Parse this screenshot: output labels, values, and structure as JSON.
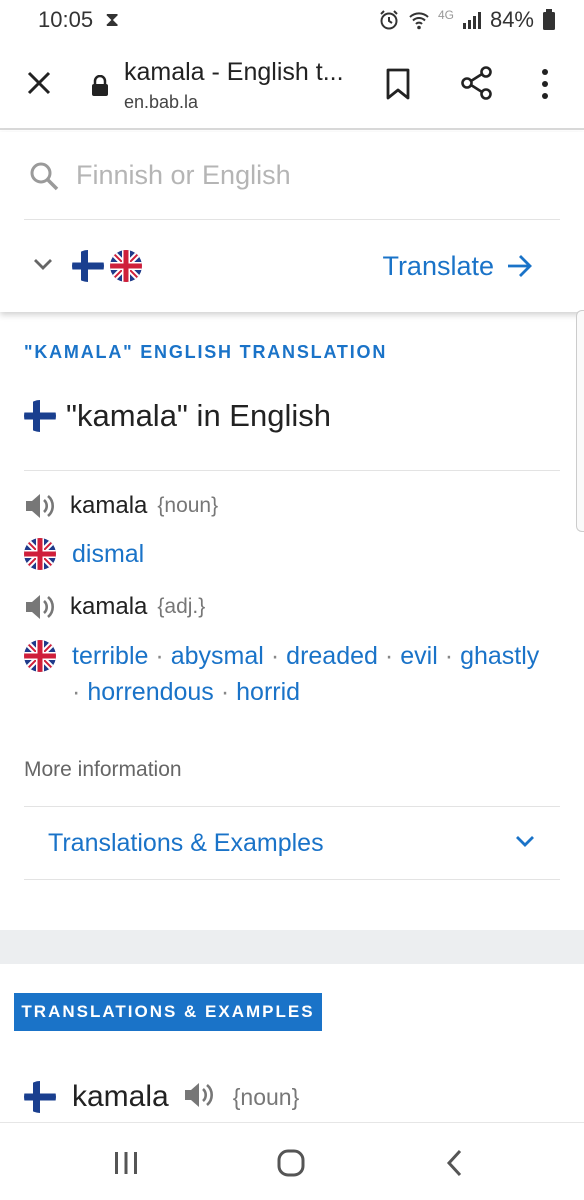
{
  "status_bar": {
    "time": "10:05",
    "network": "4G",
    "battery": "84%"
  },
  "browser": {
    "page_title": "kamala - English t...",
    "url": "en.bab.la"
  },
  "search": {
    "placeholder": "Finnish or English",
    "translate_label": "Translate"
  },
  "section": {
    "heading": "\"KAMALA\" ENGLISH TRANSLATION",
    "headword": "\"kamala\" in English"
  },
  "entries": [
    {
      "word": "kamala",
      "pos": "{noun}",
      "translations": [
        "dismal"
      ]
    },
    {
      "word": "kamala",
      "pos": "{adj.}",
      "translations": [
        "terrible",
        "abysmal",
        "dreaded",
        "evil",
        "ghastly",
        "horrendous",
        "horrid"
      ]
    }
  ],
  "more_info": {
    "label": "More information",
    "accordion_label": "Translations & Examples"
  },
  "examples": {
    "badge": "TRANSLATIONS & EXAMPLES",
    "word": "kamala",
    "pos": "{noun}"
  },
  "colors": {
    "accent": "#1a73c8",
    "text": "#222222",
    "muted": "#777777",
    "band": "#eceef0"
  },
  "icons": [
    "hourglass-icon",
    "alarm-icon",
    "wifi-icon",
    "signal-icon",
    "battery-icon",
    "close-icon",
    "lock-icon",
    "bookmark-icon",
    "share-icon",
    "more-vert-icon",
    "search-icon",
    "chevron-down-icon",
    "flag-finland-icon",
    "flag-uk-icon",
    "arrow-right-icon",
    "speaker-icon",
    "recent-apps-icon",
    "home-icon",
    "back-icon"
  ]
}
